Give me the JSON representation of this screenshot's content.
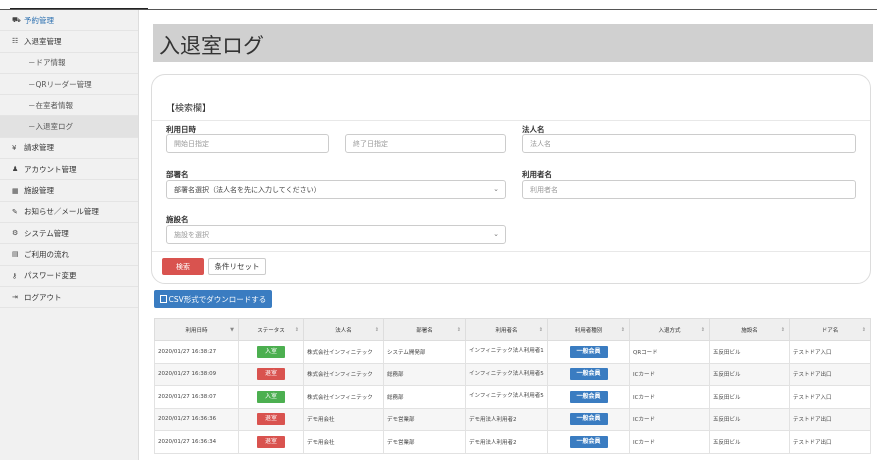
{
  "sidebar": {
    "items": [
      {
        "icon": "cart",
        "label": "予約管理"
      },
      {
        "icon": "list",
        "label": "入退室管理"
      },
      {
        "icon": "",
        "label": "ドア情報"
      },
      {
        "icon": "",
        "label": "QRリーダー管理"
      },
      {
        "icon": "",
        "label": "在室者情報"
      },
      {
        "icon": "",
        "label": "入退室ログ"
      },
      {
        "icon": "yen",
        "label": "請求管理"
      },
      {
        "icon": "user",
        "label": "アカウント管理"
      },
      {
        "icon": "building",
        "label": "施設管理"
      },
      {
        "icon": "edit",
        "label": "お知らせ／メール管理"
      },
      {
        "icon": "gear",
        "label": "システム管理"
      },
      {
        "icon": "book",
        "label": "ご利用の流れ"
      },
      {
        "icon": "key",
        "label": "パスワード変更"
      },
      {
        "icon": "logout",
        "label": "ログアウト"
      }
    ]
  },
  "page": {
    "title": "入退室ログ"
  },
  "search": {
    "heading": "【検索欄】",
    "date_label": "利用日時",
    "start_placeholder": "開始日指定",
    "end_placeholder": "終了日指定",
    "corp_label": "法人名",
    "corp_placeholder": "法人名",
    "dept_label": "部署名",
    "dept_value": "部署名選択（法人名を先に入力してください）",
    "user_label": "利用者名",
    "user_placeholder": "利用者名",
    "facility_label": "施設名",
    "facility_value": "施設を選択",
    "search_button": "検索",
    "reset_button": "条件リセット"
  },
  "csv_button": "CSV形式でダウンロードする",
  "table": {
    "headers": [
      "利用日時",
      "ステータス",
      "法人名",
      "部署名",
      "利用者名",
      "利用者種別",
      "入退方式",
      "施設名",
      "ドア名"
    ],
    "rows": [
      {
        "date": "2020/01/27 16:38:27",
        "status": "入室",
        "status_type": "in",
        "corp": "株式会社インフィニテック",
        "dept": "システム開発部",
        "user": "インフィニテック法人利用者1",
        "kind": "一般会員",
        "method": "QRコード",
        "facility": "五反田ビル",
        "door": "テストドア入口"
      },
      {
        "date": "2020/01/27 16:38:09",
        "status": "退室",
        "status_type": "out",
        "corp": "株式会社インフィニテック",
        "dept": "総務部",
        "user": "インフィニテック法人利用者5",
        "kind": "一般会員",
        "method": "ICカード",
        "facility": "五反田ビル",
        "door": "テストドア出口"
      },
      {
        "date": "2020/01/27 16:38:07",
        "status": "入室",
        "status_type": "in",
        "corp": "株式会社インフィニテック",
        "dept": "総務部",
        "user": "インフィニテック法人利用者5",
        "kind": "一般会員",
        "method": "ICカード",
        "facility": "五反田ビル",
        "door": "テストドア入口"
      },
      {
        "date": "2020/01/27 16:36:36",
        "status": "退室",
        "status_type": "out",
        "corp": "デモ用会社",
        "dept": "デモ営業部",
        "user": "デモ用法人利用者2",
        "kind": "一般会員",
        "method": "ICカード",
        "facility": "五反田ビル",
        "door": "テストドア出口"
      },
      {
        "date": "2020/01/27 16:36:34",
        "status": "退室",
        "status_type": "out",
        "corp": "デモ用会社",
        "dept": "デモ営業部",
        "user": "デモ用法人利用者2",
        "kind": "一般会員",
        "method": "ICカード",
        "facility": "五反田ビル",
        "door": "テストドア出口"
      }
    ]
  },
  "colors": {
    "accent": "#3a7cc1",
    "danger": "#d9534f",
    "success": "#4caf50"
  }
}
